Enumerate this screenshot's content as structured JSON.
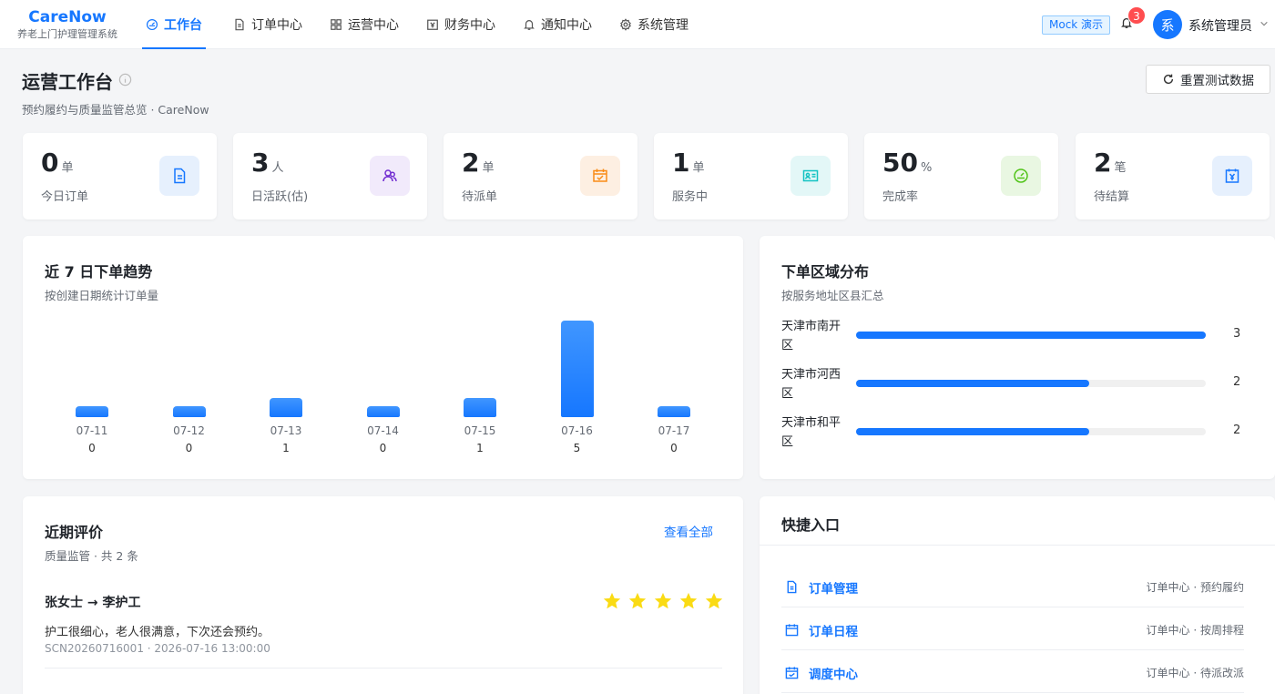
{
  "brand": {
    "name": "CareNow",
    "subtitle": "养老上门护理管理系统"
  },
  "nav": [
    {
      "label": "工作台",
      "icon": "dashboard-icon",
      "active": true
    },
    {
      "label": "订单中心",
      "icon": "document-icon"
    },
    {
      "label": "运营中心",
      "icon": "grid-icon"
    },
    {
      "label": "财务中心",
      "icon": "finance-icon"
    },
    {
      "label": "通知中心",
      "icon": "bell-icon"
    },
    {
      "label": "系统管理",
      "icon": "gear-icon"
    }
  ],
  "header": {
    "mock_tag": "Mock 演示",
    "notification_count": "3",
    "avatar_char": "系",
    "username": "系统管理员"
  },
  "page": {
    "title": "运营工作台",
    "subtitle": "预约履约与质量监管总览 · CareNow",
    "reset_button": "重置测试数据"
  },
  "stats": [
    {
      "value": "0",
      "unit": "单",
      "label": "今日订单",
      "icon": "document-icon",
      "color": "#1677ff",
      "bg": "#e6f0fd"
    },
    {
      "value": "3",
      "unit": "人",
      "label": "日活跃(估)",
      "icon": "users-icon",
      "color": "#722ed1",
      "bg": "#f1eafb"
    },
    {
      "value": "2",
      "unit": "单",
      "label": "待派单",
      "icon": "calendar-check-icon",
      "color": "#fa8c16",
      "bg": "#fdefe2"
    },
    {
      "value": "1",
      "unit": "单",
      "label": "服务中",
      "icon": "id-card-icon",
      "color": "#13c2c2",
      "bg": "#e3f7f7"
    },
    {
      "value": "50",
      "unit": "%",
      "label": "完成率",
      "icon": "gauge-icon",
      "color": "#52c41a",
      "bg": "#e9f7e2"
    },
    {
      "value": "2",
      "unit": "笔",
      "label": "待结算",
      "icon": "yen-calendar-icon",
      "color": "#1677ff",
      "bg": "#e6f0fd"
    }
  ],
  "trend": {
    "title": "近 7 日下单趋势",
    "subtitle": "按创建日期统计订单量"
  },
  "chart_data": {
    "type": "bar",
    "categories": [
      "07-11",
      "07-12",
      "07-13",
      "07-14",
      "07-15",
      "07-16",
      "07-17"
    ],
    "values": [
      0,
      0,
      1,
      0,
      1,
      5,
      0
    ],
    "title": "近 7 日下单趋势",
    "xlabel": "",
    "ylabel": "",
    "ylim": [
      0,
      5
    ],
    "grid": false,
    "color": "#1677ff"
  },
  "region": {
    "title": "下单区域分布",
    "subtitle": "按服务地址区县汇总",
    "items": [
      {
        "name": "天津市南开区",
        "count": 3
      },
      {
        "name": "天津市河西区",
        "count": 2
      },
      {
        "name": "天津市和平区",
        "count": 2
      }
    ]
  },
  "reviews": {
    "title": "近期评价",
    "subtitle": "质量监管 · 共 2 条",
    "view_all": "查看全部",
    "items": [
      {
        "head": "张女士 → 李护工",
        "rating": 5,
        "text": "护工很细心，老人很满意，下次还会预约。",
        "meta": "SCN20260716001 · 2026-07-16 13:00:00"
      }
    ]
  },
  "quick": {
    "title": "快捷入口",
    "items": [
      {
        "name": "订单管理",
        "desc": "订单中心 · 预约履约",
        "icon": "document-icon"
      },
      {
        "name": "订单日程",
        "desc": "订单中心 · 按周排程",
        "icon": "calendar-icon"
      },
      {
        "name": "调度中心",
        "desc": "订单中心 · 待派改派",
        "icon": "dispatch-icon"
      }
    ]
  }
}
